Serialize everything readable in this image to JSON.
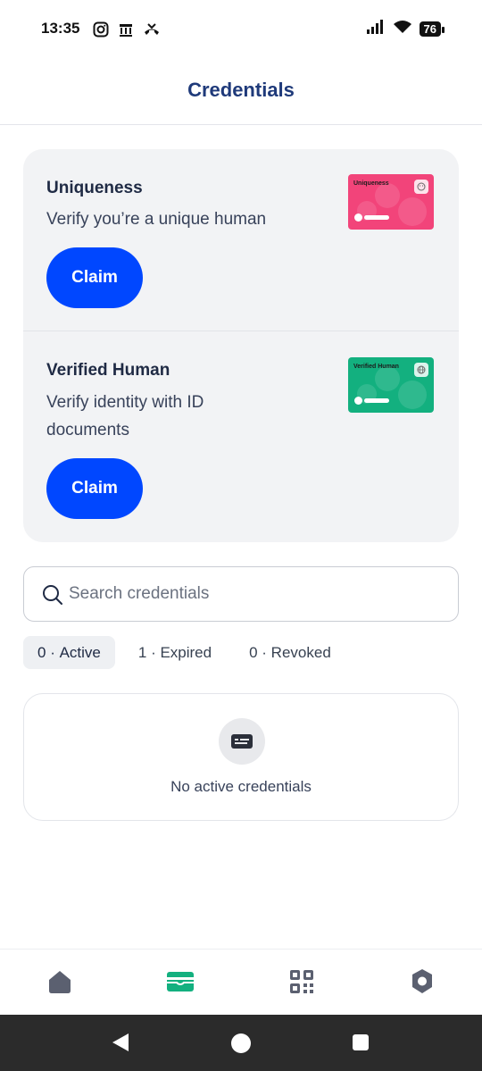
{
  "status_bar": {
    "time": "13:35",
    "battery": "76",
    "left_icons": [
      "instagram-icon",
      "building-icon",
      "call-missed-icon"
    ],
    "right_icons": [
      "signal-icon",
      "wifi-icon",
      "battery-icon"
    ]
  },
  "header": {
    "title": "Credentials"
  },
  "claim_cards": [
    {
      "title": "Uniqueness",
      "description": "Verify you’re a unique human",
      "button": "Claim",
      "card_label": "Uniqueness",
      "card_color": "#f2447a"
    },
    {
      "title": "Verified Human",
      "description": "Verify identity with ID documents",
      "button": "Claim",
      "card_label": "Verified Human",
      "card_color": "#13b07f"
    }
  ],
  "search": {
    "placeholder": "Search credentials",
    "value": ""
  },
  "tabs": [
    {
      "count": "0",
      "label": "Active",
      "selected": true
    },
    {
      "count": "1",
      "label": "Expired",
      "selected": false
    },
    {
      "count": "0",
      "label": "Revoked",
      "selected": false
    }
  ],
  "empty_state": {
    "text": "No active credentials",
    "icon": "credential-card-icon"
  },
  "bottom_nav": {
    "items": [
      "home-icon",
      "wallet-icon",
      "qr-scan-icon",
      "settings-icon"
    ],
    "active_index": 1,
    "active_color": "#13b07f",
    "inactive_color": "#5b6070"
  },
  "colors": {
    "accent": "#0047ff",
    "title": "#1f3a7a"
  }
}
